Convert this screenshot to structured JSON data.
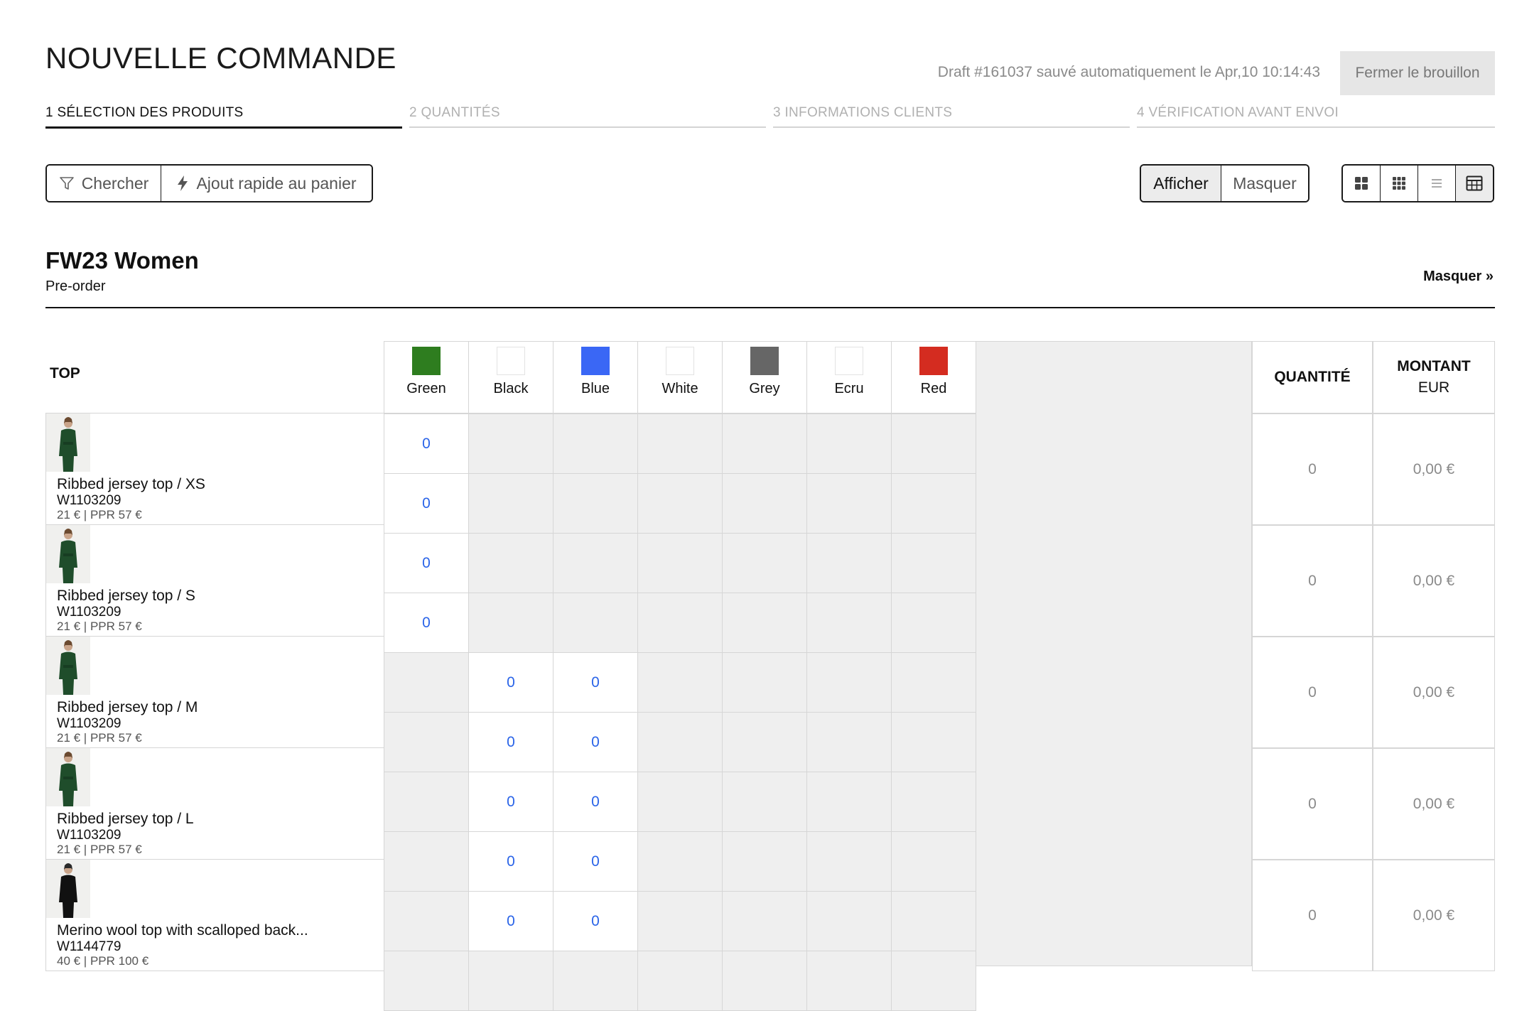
{
  "header": {
    "title": "NOUVELLE COMMANDE",
    "draft_status": "Draft #161037 sauvé automatiquement le Apr,10 10:14:43",
    "close_draft_label": "Fermer le brouillon"
  },
  "steps": [
    {
      "label": "1 SÉLECTION DES PRODUITS",
      "active": true
    },
    {
      "label": "2 QUANTITÉS",
      "active": false
    },
    {
      "label": "3 INFORMATIONS CLIENTS",
      "active": false
    },
    {
      "label": "4 VÉRIFICATION AVANT ENVOI",
      "active": false
    }
  ],
  "toolbar": {
    "search_label": "Chercher",
    "search_icon": "filter-icon",
    "quick_add_label": "Ajout rapide au panier",
    "quick_add_icon": "lightning-icon",
    "show_label": "Afficher",
    "hide_label": "Masquer",
    "view_modes": [
      "grid-large-icon",
      "grid-small-icon",
      "list-icon",
      "table-icon"
    ],
    "active_view": "table-icon"
  },
  "collection": {
    "name": "FW23 Women",
    "type": "Pre-order",
    "collapse_label": "Masquer »"
  },
  "table": {
    "category_label": "TOP",
    "colors": [
      {
        "name": "Green",
        "hex": "#2e7d1f"
      },
      {
        "name": "Black",
        "hex": "#ffffff"
      },
      {
        "name": "Blue",
        "hex": "#3a67f5"
      },
      {
        "name": "White",
        "hex": "#ffffff"
      },
      {
        "name": "Grey",
        "hex": "#666666"
      },
      {
        "name": "Ecru",
        "hex": "#ffffff"
      },
      {
        "name": "Red",
        "hex": "#d42c20"
      }
    ],
    "quantity_header": "QUANTITÉ",
    "amount_header": "MONTANT",
    "currency": "EUR",
    "cell_value": "0",
    "products": [
      {
        "name": "Ribbed jersey top / XS",
        "ref": "W1103209",
        "price": "21 € | PPR 57 €",
        "quantity": "0",
        "amount": "0,00 €"
      },
      {
        "name": "Ribbed jersey top / S",
        "ref": "W1103209",
        "price": "21 € | PPR 57 €",
        "quantity": "0",
        "amount": "0,00 €"
      },
      {
        "name": "Ribbed jersey top / M",
        "ref": "W1103209",
        "price": "21 € | PPR 57 €",
        "quantity": "0",
        "amount": "0,00 €"
      },
      {
        "name": "Ribbed jersey top / L",
        "ref": "W1103209",
        "price": "21 € | PPR 57 €",
        "quantity": "0",
        "amount": "0,00 €"
      },
      {
        "name": "Merino wool top with scalloped back...",
        "ref": "W1144779",
        "price": "40 € | PPR 100 €",
        "quantity": "0",
        "amount": "0,00 €"
      }
    ],
    "grid_rows": [
      {
        "enabled": [
          0
        ]
      },
      {
        "enabled": [
          0
        ]
      },
      {
        "enabled": [
          0
        ]
      },
      {
        "enabled": [
          0
        ]
      },
      {
        "enabled": [
          1,
          2
        ]
      },
      {
        "enabled": [
          1,
          2
        ]
      },
      {
        "enabled": [
          1,
          2
        ]
      },
      {
        "enabled": [
          1,
          2
        ]
      },
      {
        "enabled": [
          1,
          2
        ]
      },
      {
        "enabled": []
      }
    ]
  }
}
